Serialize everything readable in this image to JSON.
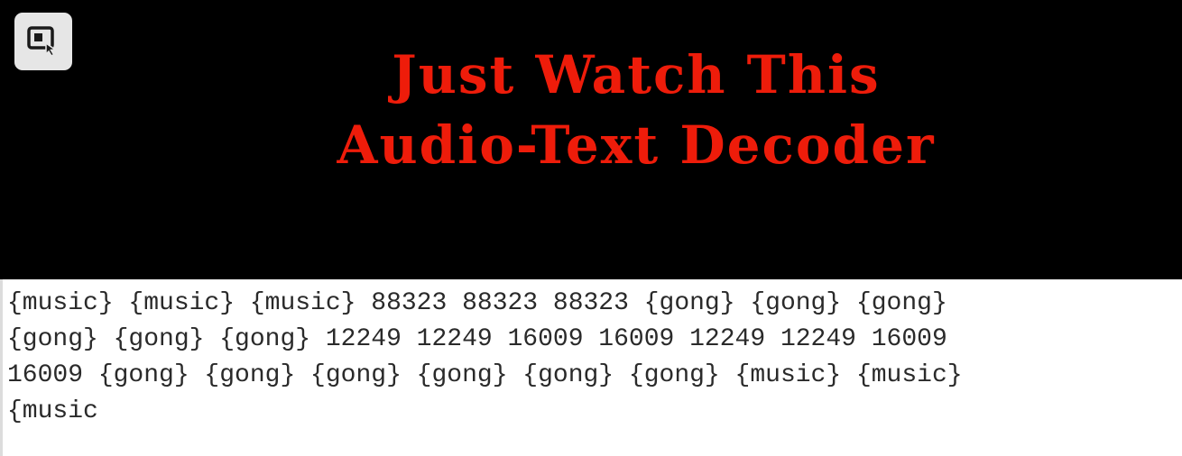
{
  "banner": {
    "title_line_1": "Just Watch This",
    "title_line_2": "Audio-Text Decoder",
    "title_color": "#ee1c0a",
    "background_color": "#000000"
  },
  "toolbar": {
    "select_button_icon": "screen-select-icon"
  },
  "transcript": {
    "lines": [
      "{music} {music} {music} 88323 88323 88323 {gong} {gong} {gong}",
      "{gong} {gong} {gong} 12249 12249 16009 16009 12249 12249 16009",
      "16009 {gong} {gong} {gong} {gong} {gong} {gong} {music} {music}",
      "{music"
    ]
  }
}
